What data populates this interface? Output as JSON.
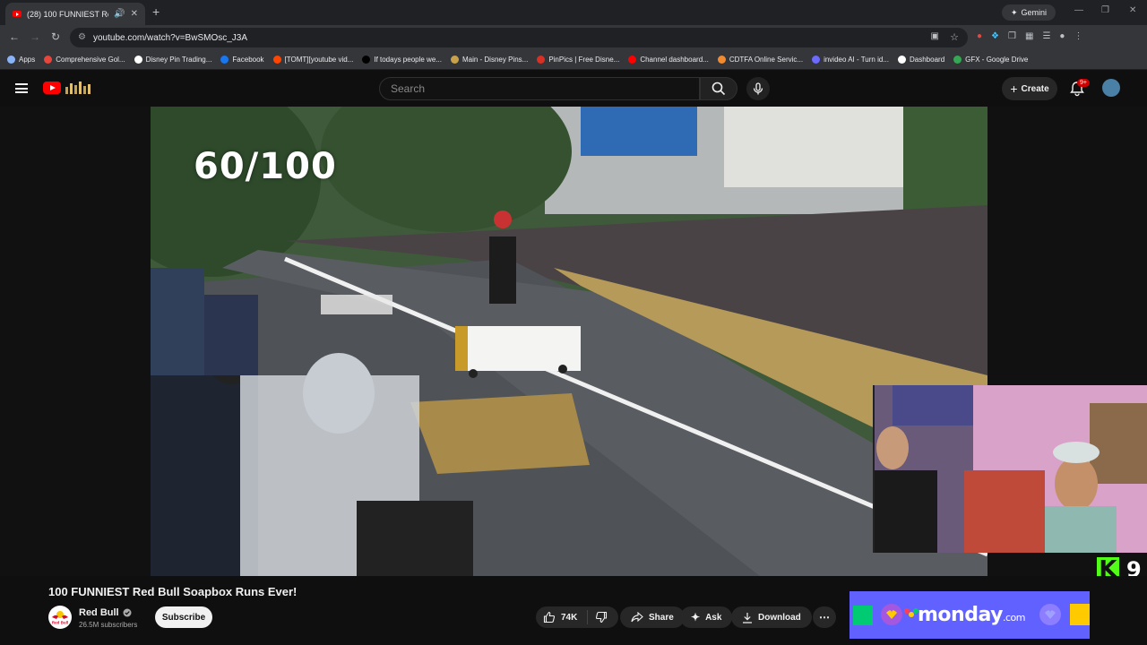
{
  "browser": {
    "tab_title": "(28) 100 FUNNIEST Red Bull",
    "new_tab": "+",
    "gemini_label": "Gemini",
    "url": "youtube.com/watch?v=BwSMOsc_J3A"
  },
  "bookmarks": [
    {
      "label": "Apps",
      "color": "#8ab4f8"
    },
    {
      "label": "Comprehensive Gol...",
      "color": "#e8453c"
    },
    {
      "label": "Disney Pin Trading...",
      "color": "#ffffff"
    },
    {
      "label": "Facebook",
      "color": "#1877f2"
    },
    {
      "label": "[TOMT][youtube vid...",
      "color": "#ff4500"
    },
    {
      "label": "If todays people we...",
      "color": "#000000"
    },
    {
      "label": "Main - Disney Pins...",
      "color": "#c8a24a"
    },
    {
      "label": "PinPics | Free Disne...",
      "color": "#d93025"
    },
    {
      "label": "Channel dashboard...",
      "color": "#ff0000"
    },
    {
      "label": "CDTFA Online Servic...",
      "color": "#f28b30"
    },
    {
      "label": "invideo AI - Turn id...",
      "color": "#6b6bff"
    },
    {
      "label": "Dashboard",
      "color": "#ffffff"
    },
    {
      "label": "GFX - Google Drive",
      "color": "#34a853"
    }
  ],
  "youtube": {
    "search_placeholder": "Search",
    "create_label": "Create",
    "notif_badge": "9+"
  },
  "video": {
    "counter": "60/100",
    "title": "100 FUNNIEST Red Bull Soapbox Runs Ever!"
  },
  "overlay": {
    "kick_letter": "K",
    "kick_count": "9"
  },
  "channel": {
    "name": "Red Bull",
    "subscribers": "26.5M subscribers",
    "logo_text": "Red Bull"
  },
  "actions": {
    "subscribe": "Subscribe",
    "likes": "74K",
    "share": "Share",
    "ask": "Ask",
    "download": "Download"
  },
  "ad": {
    "brand": "monday",
    "suffix": ".com"
  }
}
